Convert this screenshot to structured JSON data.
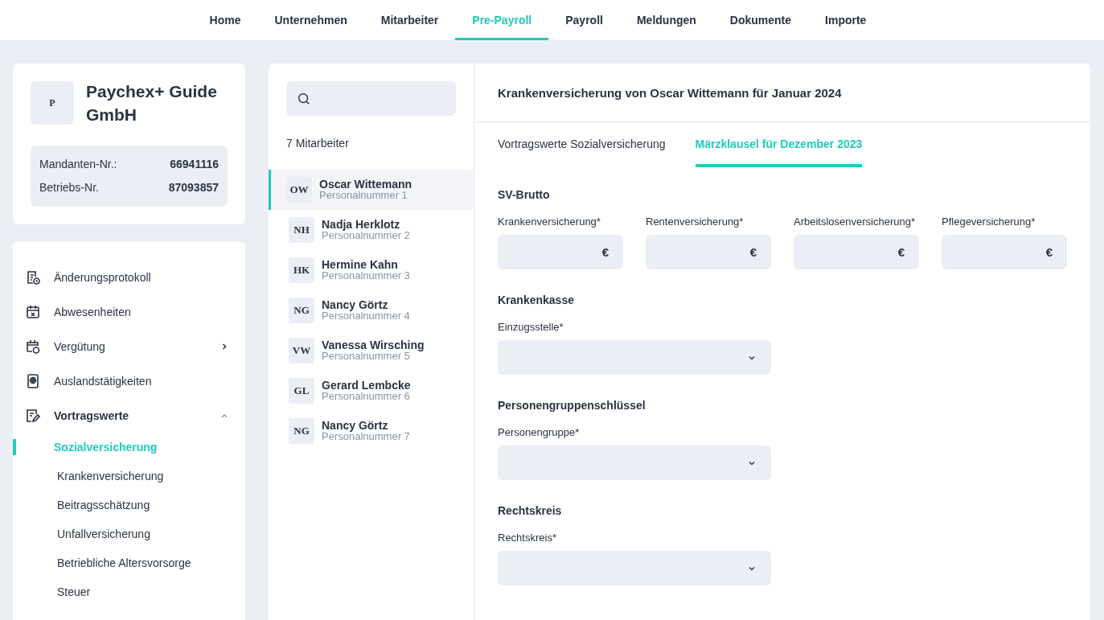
{
  "nav": [
    {
      "label": "Home",
      "selected": false
    },
    {
      "label": "Unternehmen",
      "selected": false
    },
    {
      "label": "Mitarbeiter",
      "selected": false
    },
    {
      "label": "Pre-Payroll",
      "selected": true
    },
    {
      "label": "Payroll",
      "selected": false
    },
    {
      "label": "Meldungen",
      "selected": false
    },
    {
      "label": "Dokumente",
      "selected": false
    },
    {
      "label": "Importe",
      "selected": false
    }
  ],
  "company": {
    "logo": "P",
    "name": "Paychex+ Guide GmbH",
    "info": [
      {
        "label": "Mandanten-Nr.:",
        "value": "66941116"
      },
      {
        "label": "Betriebs-Nr.",
        "value": "87093857"
      }
    ]
  },
  "sidebar": {
    "items": [
      {
        "label": "Änderungsprotokoll",
        "selected": false
      },
      {
        "label": "Abwesenheiten",
        "selected": false
      },
      {
        "label": "Vergütung",
        "selected": false,
        "expanded": false
      },
      {
        "label": "Auslandstätigkeiten",
        "selected": false
      },
      {
        "label": "Vortragswerte",
        "selected": true,
        "expanded": true,
        "children": [
          {
            "label": "Sozialversicherung",
            "selected": true
          },
          {
            "label": "Krankenversicherung",
            "selected": false
          },
          {
            "label": "Beitragsschätzung",
            "selected": false
          },
          {
            "label": "Unfallversicherung",
            "selected": false
          },
          {
            "label": "Betriebliche Altersvorsorge",
            "selected": false
          },
          {
            "label": "Steuer",
            "selected": false
          }
        ]
      }
    ]
  },
  "employees": {
    "count": "7 Mitarbeiter",
    "items": [
      {
        "initials": "OW",
        "name": "Oscar Wittemann",
        "number": "Personalnummer 1",
        "selected": true
      },
      {
        "initials": "NH",
        "name": "Nadja Herklotz",
        "number": "Personalnummer 2",
        "selected": false
      },
      {
        "initials": "HK",
        "name": "Hermine Kahn",
        "number": "Personalnummer 3",
        "selected": false
      },
      {
        "initials": "NG",
        "name": "Nancy Görtz",
        "number": "Personalnummer 4",
        "selected": false
      },
      {
        "initials": "VW",
        "name": "Vanessa Wirsching",
        "number": "Personalnummer 5",
        "selected": false
      },
      {
        "initials": "GL",
        "name": "Gerard Lembcke",
        "number": "Personalnummer 6",
        "selected": false
      },
      {
        "initials": "NG",
        "name": "Nancy Görtz",
        "number": "Personalnummer 7",
        "selected": false
      }
    ]
  },
  "detail": {
    "title": "Krankenversicherung von Oscar Wittemann für Januar 2024",
    "tabs": [
      {
        "label": "Vortragswerte Sozialversicherung",
        "selected": false
      },
      {
        "label": "Märzklausel für Dezember 2023",
        "selected": true
      }
    ],
    "sections": [
      {
        "title": "SV-Brutto",
        "fields": [
          {
            "kind": "currency",
            "label": "Krankenversicherung*",
            "unit": "€"
          },
          {
            "kind": "currency",
            "label": "Rentenversicherung*",
            "unit": "€"
          },
          {
            "kind": "currency",
            "label": "Arbeitslosenversicherung*",
            "unit": "€"
          },
          {
            "kind": "currency",
            "label": "Pflegeversicherung*",
            "unit": "€"
          }
        ]
      },
      {
        "title": "Krankenkasse",
        "fields": [
          {
            "kind": "select",
            "label": "Einzugsstelle*"
          }
        ]
      },
      {
        "title": "Personengruppenschlüssel",
        "fields": [
          {
            "kind": "select",
            "label": "Personengruppe*"
          }
        ]
      },
      {
        "title": "Rechtskreis",
        "fields": [
          {
            "kind": "select",
            "label": "Rechtskreis*"
          }
        ]
      }
    ]
  }
}
